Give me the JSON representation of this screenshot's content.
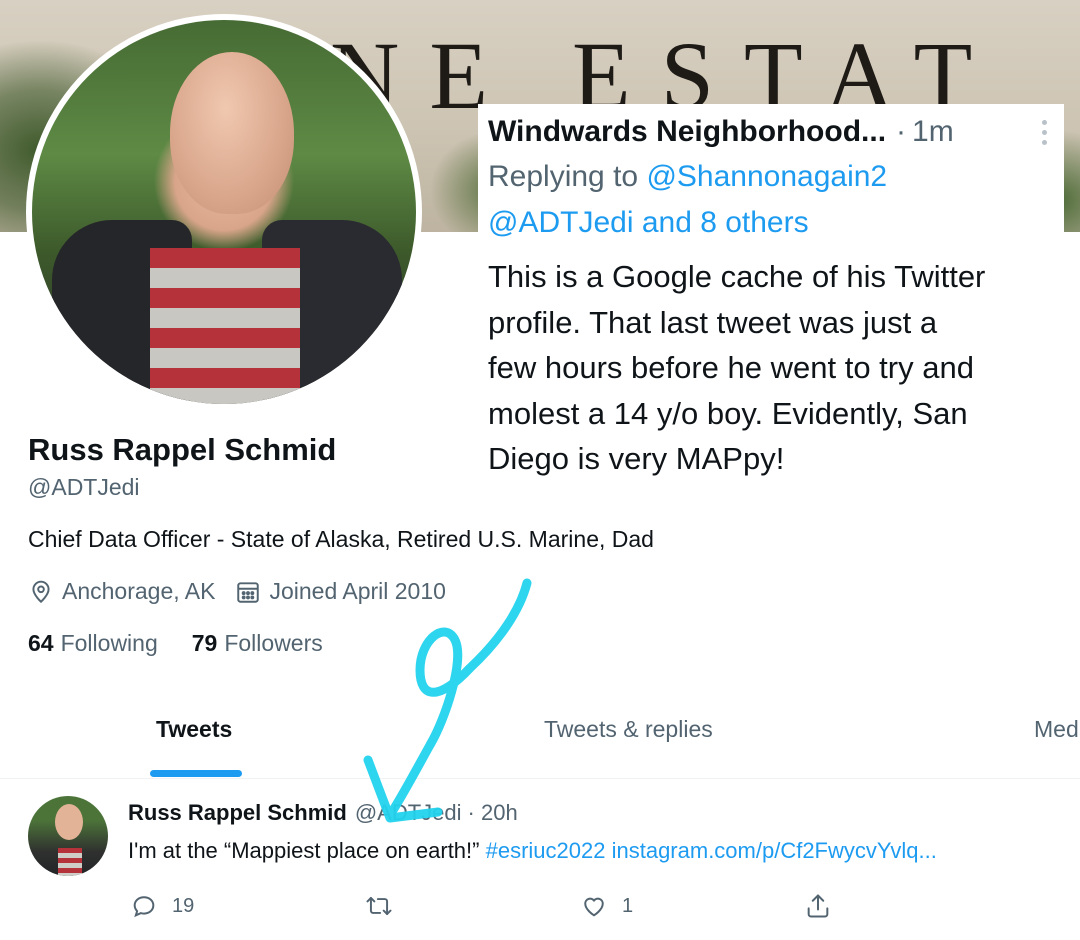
{
  "reply": {
    "author": "Windwards Neighborhood...",
    "dot": "·",
    "time": "1m",
    "replying_to_prefix": "Replying to ",
    "mentions_line1": "@Shannonagain2",
    "mentions_line2": "@ADTJedi and 8 others",
    "body": "This is a Google cache of his Twitter\nprofile.  That last tweet was just a\nfew hours before he went to try and\nmolest a 14 y/o boy.  Evidently, San\nDiego is very MAPpy!"
  },
  "banner": {
    "letters": "NE ESTAT"
  },
  "profile": {
    "name": "Russ Rappel Schmid",
    "handle": "@ADTJedi",
    "bio": "Chief Data Officer - State of Alaska, Retired U.S. Marine, Dad",
    "location": "Anchorage, AK",
    "joined": "Joined April 2010",
    "following_count": "64",
    "following_label": "Following",
    "followers_count": "79",
    "followers_label": "Followers"
  },
  "tabs": [
    {
      "label": "Tweets",
      "active": true
    },
    {
      "label": "Tweets & replies",
      "active": false
    },
    {
      "label": "Med",
      "active": false
    }
  ],
  "tweet": {
    "author": "Russ Rappel Schmid",
    "handle": "@ADTJedi",
    "time": "· 20h",
    "text_plain": "I'm at the “Mappiest place on earth!” ",
    "hashtag": "#esriuc2022",
    "link": " instagram.com/p/Cf2FwycvYvlq...",
    "replies": "19",
    "likes": "1"
  },
  "icons": {
    "location": "location-pin-icon",
    "calendar": "calendar-icon",
    "reply": "reply-icon",
    "retweet": "retweet-icon",
    "like": "heart-icon",
    "share": "share-icon",
    "more": "more-options-icon"
  },
  "colors": {
    "accent": "#1d9bf0",
    "text": "#0f1419",
    "secondary": "#536471",
    "annotation": "#22d3ee"
  }
}
